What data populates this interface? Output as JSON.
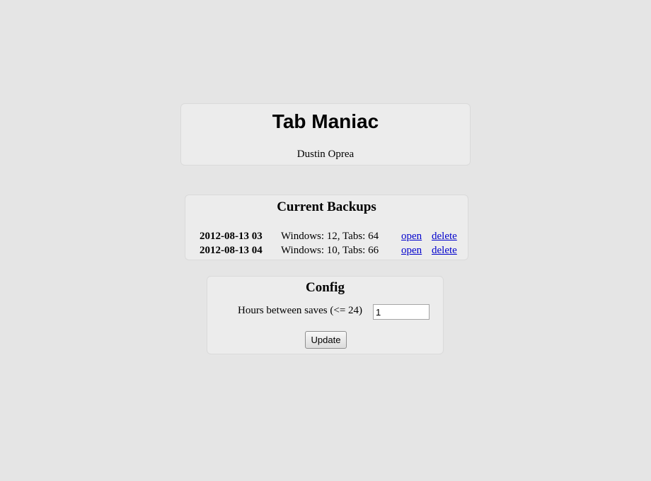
{
  "header": {
    "title": "Tab Maniac",
    "author": "Dustin Oprea"
  },
  "backups": {
    "title": "Current Backups",
    "rows": [
      {
        "date": "2012-08-13 03",
        "info": "Windows: 12, Tabs: 64",
        "open_label": "open",
        "delete_label": "delete"
      },
      {
        "date": "2012-08-13 04",
        "info": "Windows: 10, Tabs: 66",
        "open_label": "open",
        "delete_label": "delete"
      }
    ]
  },
  "config": {
    "title": "Config",
    "hours_label": "Hours between saves (<= 24)",
    "hours_value": "1",
    "update_label": "Update"
  },
  "colors": {
    "background": "#e5e5e5",
    "panel": "#ececec",
    "link": "#0000cc"
  }
}
